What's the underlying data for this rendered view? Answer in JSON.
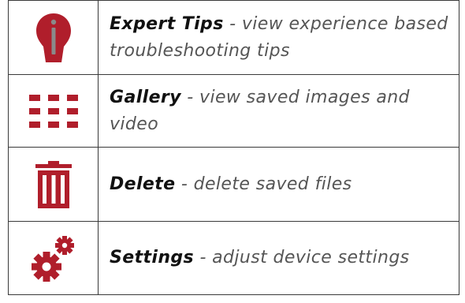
{
  "accent_color": "#b01e2b",
  "rows": [
    {
      "icon": "expert-tips-icon",
      "title": "Expert Tips",
      "description": " - view experience based troubleshooting tips"
    },
    {
      "icon": "gallery-grid-icon",
      "title": "Gallery",
      "description": " - view saved images and video"
    },
    {
      "icon": "trash-icon",
      "title": "Delete",
      "description": " - delete saved files"
    },
    {
      "icon": "gears-icon",
      "title": "Settings",
      "description": " - adjust device settings"
    }
  ]
}
